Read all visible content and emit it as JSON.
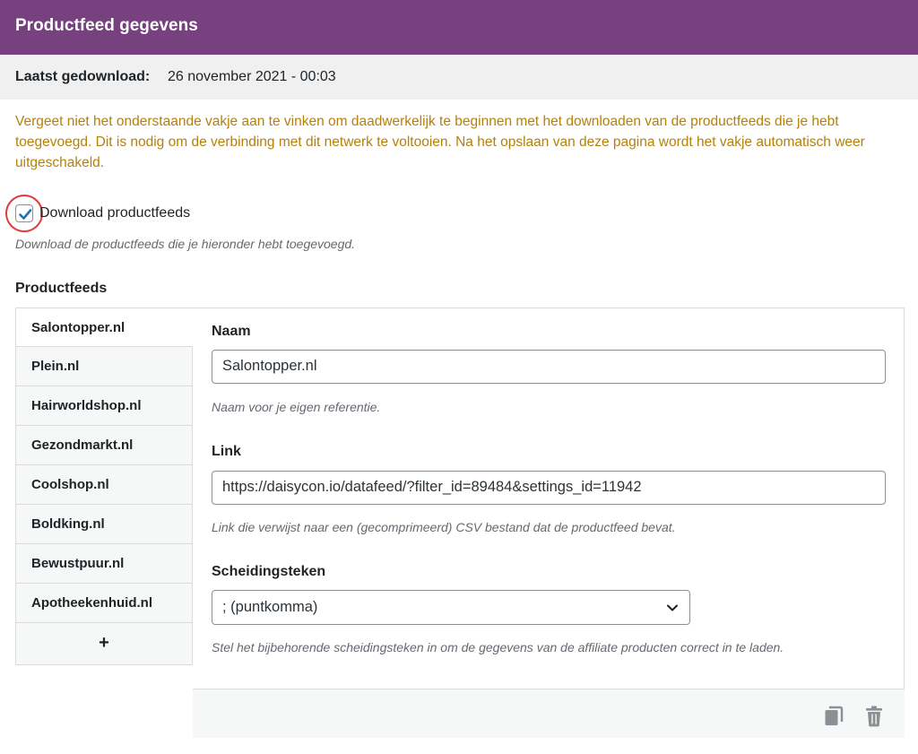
{
  "header": {
    "title": "Productfeed gegevens"
  },
  "last_download": {
    "label": "Laatst gedownload:",
    "value": "26 november 2021 - 00:03"
  },
  "notice": "Vergeet niet het onderstaande vakje aan te vinken om daadwerkelijk te beginnen met het downloaden van de productfeeds die je hebt toegevoegd. Dit is nodig om de verbinding met dit netwerk te voltooien. Na het opslaan van deze pagina wordt het vakje automatisch weer uitgeschakeld.",
  "download_checkbox": {
    "label": "Download productfeeds",
    "checked": true,
    "description": "Download de productfeeds die je hieronder hebt toegevoegd."
  },
  "feeds": {
    "title": "Productfeeds",
    "tabs": [
      "Salontopper.nl",
      "Plein.nl",
      "Hairworldshop.nl",
      "Gezondmarkt.nl",
      "Coolshop.nl",
      "Boldking.nl",
      "Bewustpuur.nl",
      "Apotheekenhuid.nl"
    ],
    "add_label": "+"
  },
  "form": {
    "name": {
      "label": "Naam",
      "value": "Salontopper.nl",
      "help": "Naam voor je eigen referentie."
    },
    "link": {
      "label": "Link",
      "value": "https://daisycon.io/datafeed/?filter_id=89484&settings_id=11942",
      "help": "Link die verwijst naar een (gecomprimeerd) CSV bestand dat de productfeed bevat."
    },
    "separator": {
      "label": "Scheidingsteken",
      "value": "; (puntkomma)",
      "help": "Stel het bijbehorende scheidingsteken in om de gegevens van de affiliate producten correct in te laden."
    }
  },
  "icons": {
    "duplicate": "copy-icon",
    "delete": "trash-icon"
  },
  "colors": {
    "header_bg": "#774180",
    "notice": "#b58109",
    "checkbox_accent": "#2271b1",
    "highlight_circle": "#e23b3b"
  }
}
